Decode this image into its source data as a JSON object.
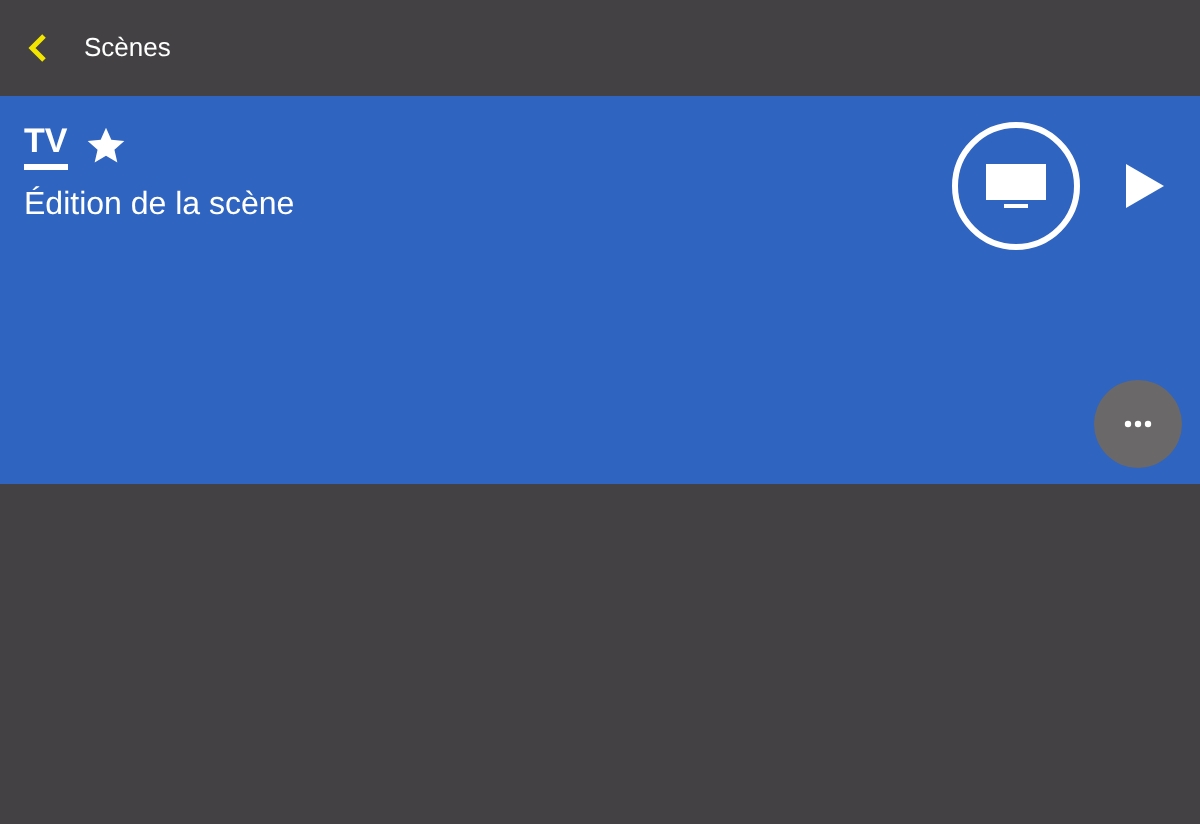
{
  "header": {
    "title": "Scènes"
  },
  "scene": {
    "name": "TV",
    "favorite": true,
    "subtitle": "Édition de la scène"
  }
}
